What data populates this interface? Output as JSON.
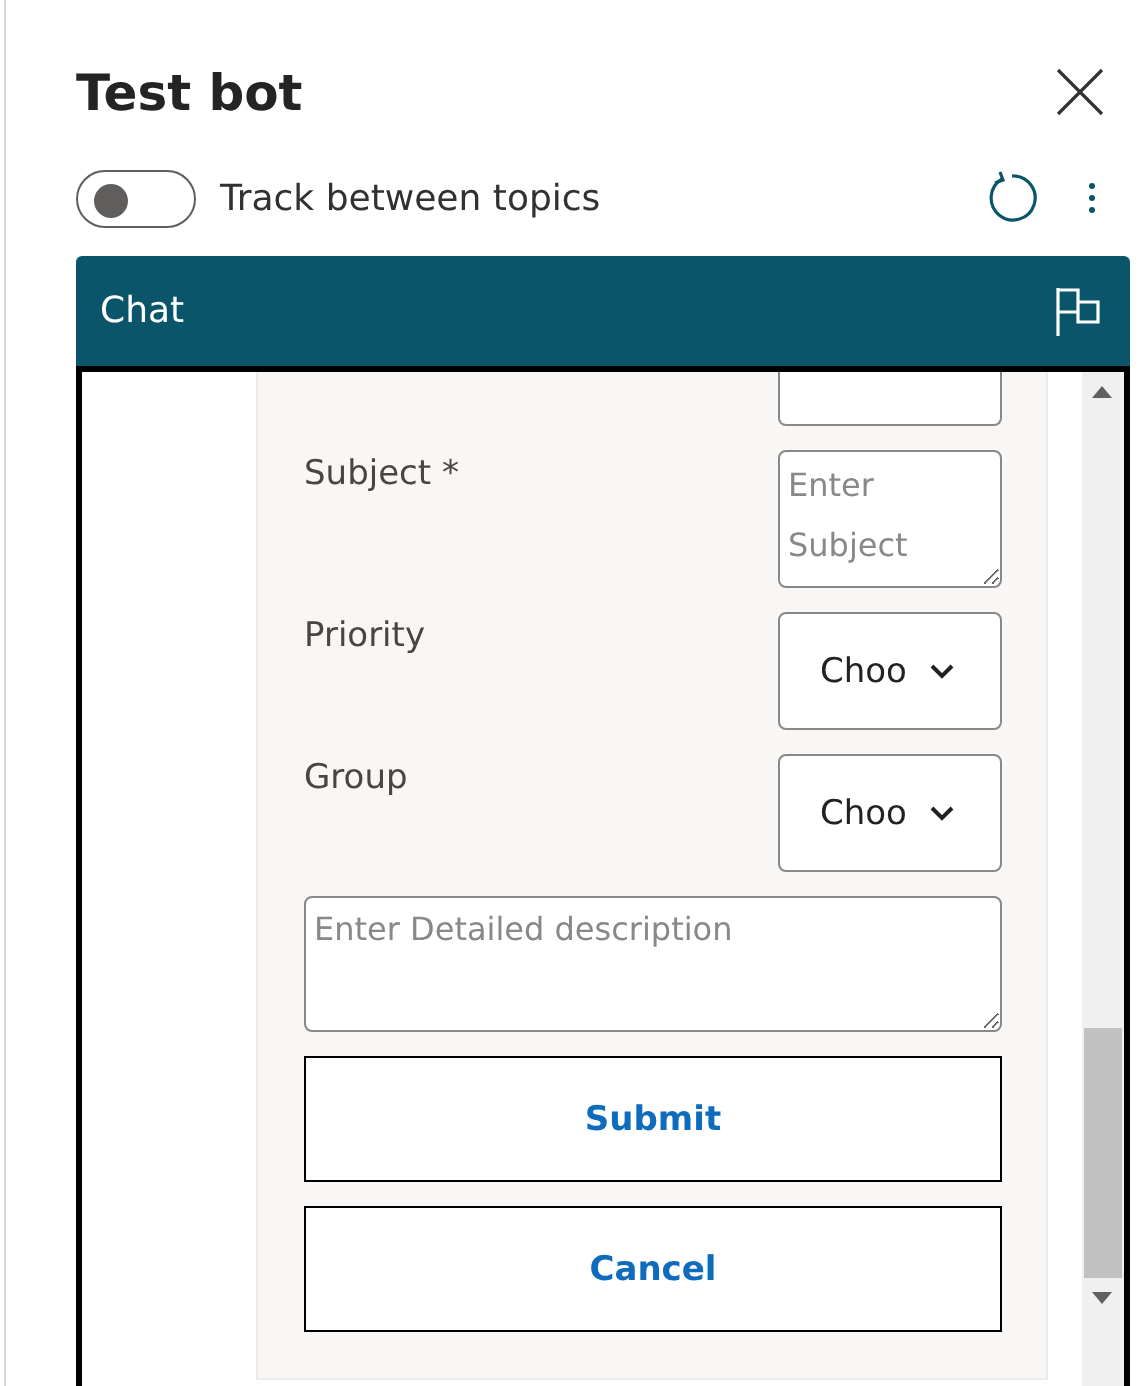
{
  "panel": {
    "title": "Test bot"
  },
  "tracking": {
    "label": "Track between topics",
    "on": false
  },
  "chat": {
    "title": "Chat",
    "form": {
      "fields": [
        {
          "kind": "partial"
        },
        {
          "kind": "textarea",
          "label": "Subject *",
          "placeholder": "Enter Subject"
        },
        {
          "kind": "select",
          "label": "Priority",
          "value": "Choo"
        },
        {
          "kind": "select",
          "label": "Group",
          "value": "Choo"
        },
        {
          "kind": "wide-textarea",
          "placeholder": "Enter Detailed description"
        }
      ],
      "buttons": [
        "Submit",
        "Cancel"
      ]
    }
  }
}
